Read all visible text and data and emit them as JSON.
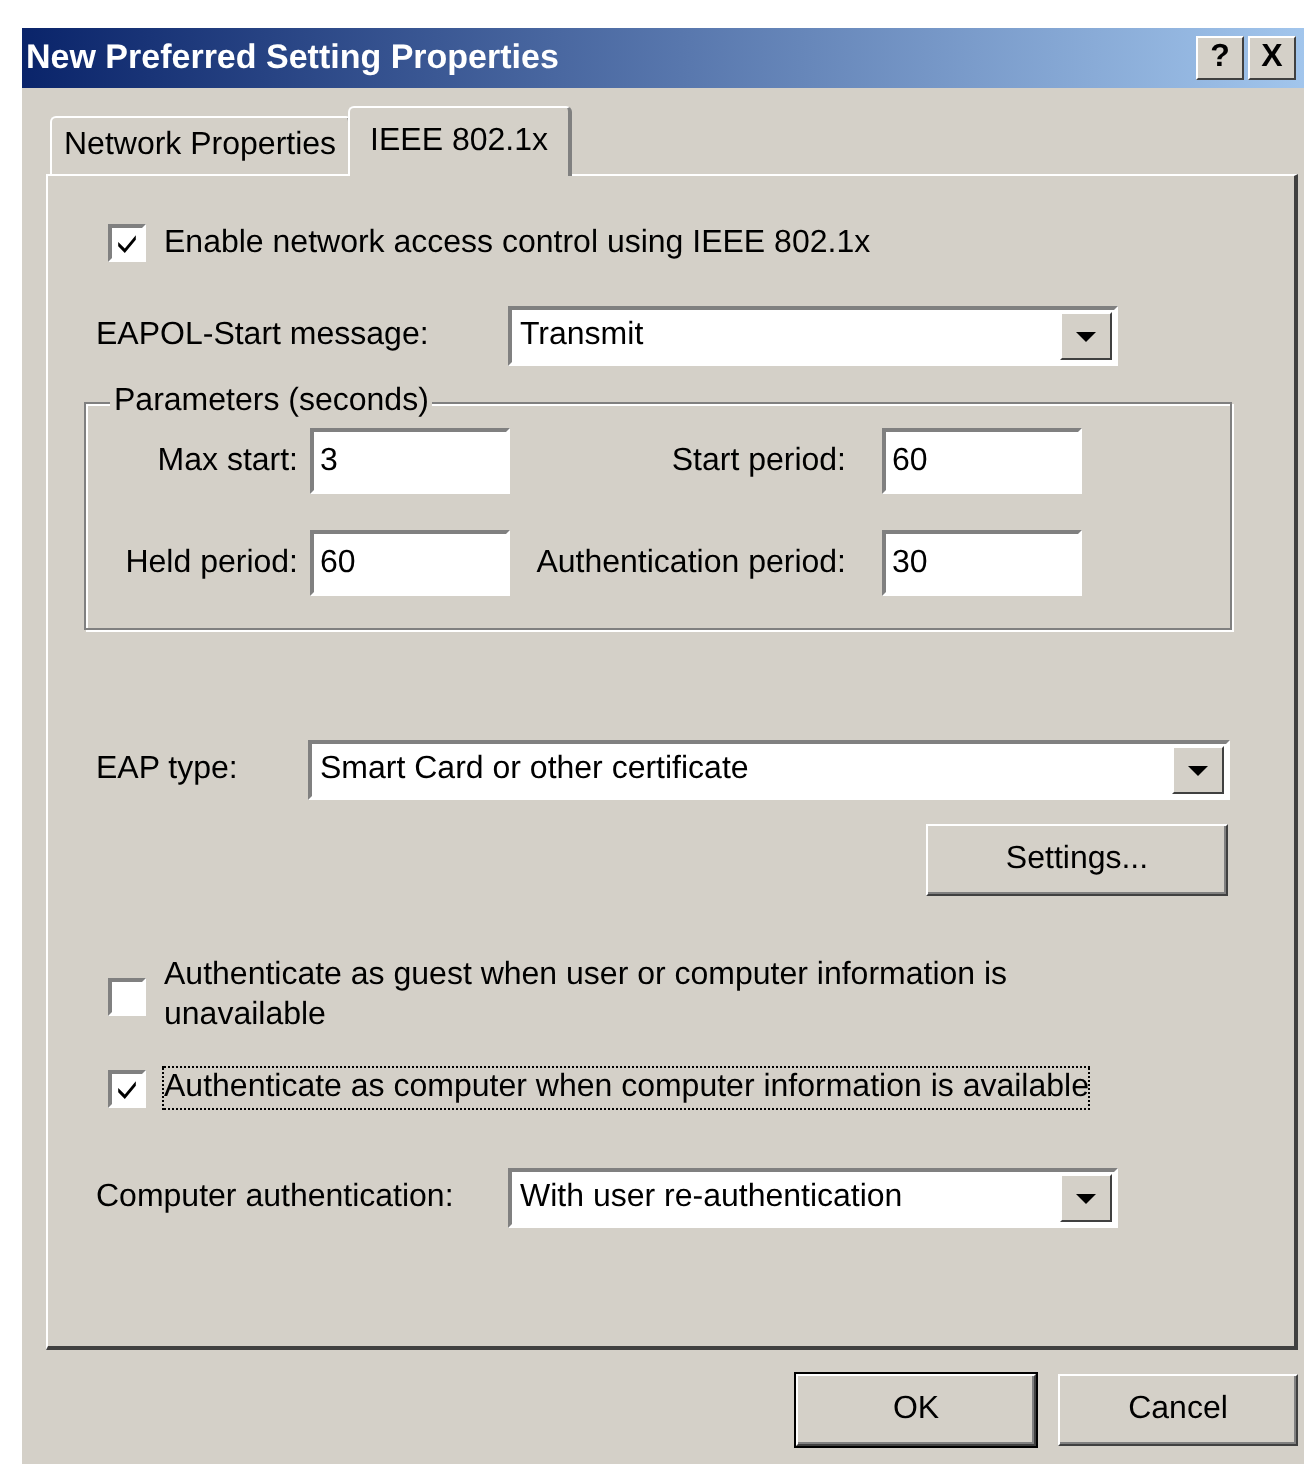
{
  "window": {
    "title": "New Preferred Setting Properties",
    "title_buttons": [
      "?",
      "X"
    ]
  },
  "tabs": [
    {
      "label": "Network Properties",
      "selected": false
    },
    {
      "label": "IEEE 802.1x",
      "selected": true
    }
  ],
  "enable_checkbox": {
    "label": "Enable network access control using IEEE 802.1x",
    "checked": true
  },
  "eapol_start": {
    "label": "EAPOL-Start message:",
    "value": "Transmit"
  },
  "parameters": {
    "title": "Parameters (seconds)",
    "fields": [
      {
        "label": "Max start:",
        "value": "3"
      },
      {
        "label": "Start period:",
        "value": "60"
      },
      {
        "label": "Held period:",
        "value": "60"
      },
      {
        "label": "Authentication period:",
        "value": "30"
      }
    ]
  },
  "eap_type": {
    "label": "EAP type:",
    "value": "Smart Card or other certificate"
  },
  "settings_button": "Settings...",
  "options": [
    {
      "label": "Authenticate as guest when user or computer information is unavailable",
      "checked": false,
      "focused": false
    },
    {
      "label": "Authenticate as computer when computer information is available",
      "checked": true,
      "focused": true
    }
  ],
  "computer_authentication": {
    "label": "Computer authentication:",
    "value": "With user re-authentication"
  },
  "buttons": [
    "OK",
    "Cancel"
  ]
}
